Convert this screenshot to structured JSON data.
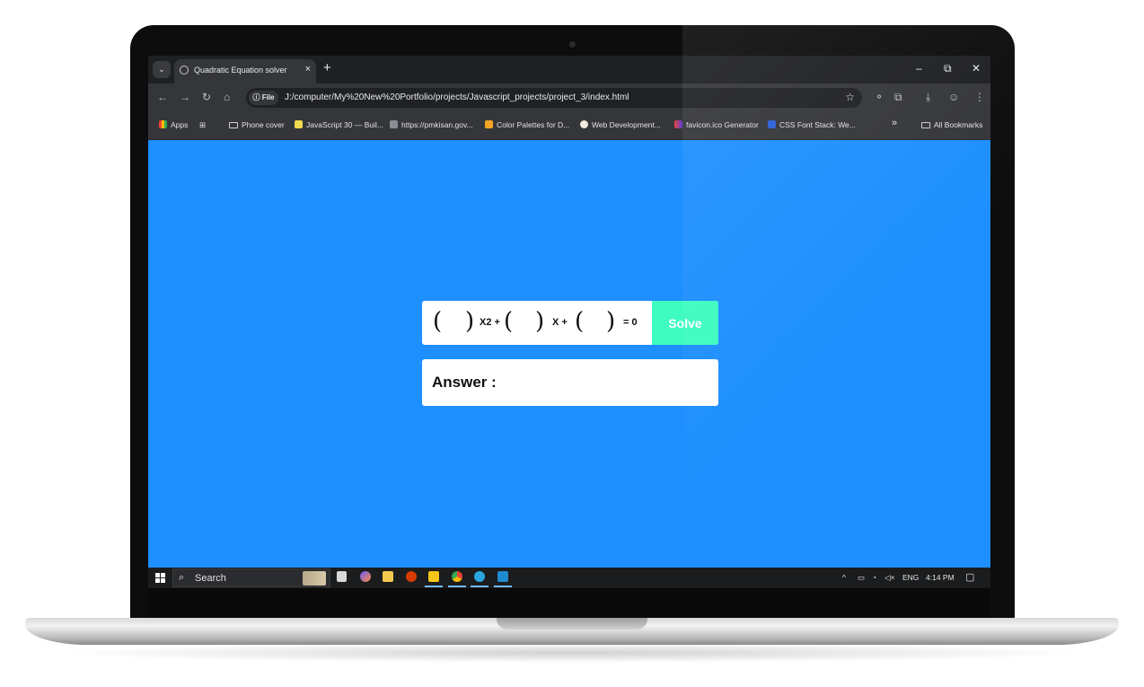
{
  "browser": {
    "tab_title": "Quadratic Equation solver",
    "tab_close": "×",
    "new_tab": "+",
    "tab_dropdown": "⌄",
    "window_min": "–",
    "window_max": "⧉",
    "window_close": "✕",
    "file_chip": "ⓘ File",
    "url": "J:/computer/My%20New%20Portfolio/projects/Javascript_projects/project_3/index.html"
  },
  "bookmarks": {
    "items": [
      "Apps",
      "Phone cover",
      "JavaScript 30 — Buil...",
      "https://pmkisan.gov...",
      "Color Palettes for D...",
      "Web Development...",
      "favicon.ico Generator",
      "CSS Font Stack: We..."
    ],
    "overflow": "»",
    "all_bookmarks": "All Bookmarks"
  },
  "equation": {
    "open_paren": "(",
    "close_paren": ")",
    "term1": "X2 +",
    "term2": "X +",
    "term3": "= 0",
    "solve_label": "Solve"
  },
  "answer": {
    "label": "Answer :"
  },
  "taskbar": {
    "search_label": "Search",
    "tray_lang": "ENG",
    "time": "4:14 PM"
  },
  "colors": {
    "page_bg": "#1e8fff",
    "solve_bg": "#3efcc0"
  }
}
